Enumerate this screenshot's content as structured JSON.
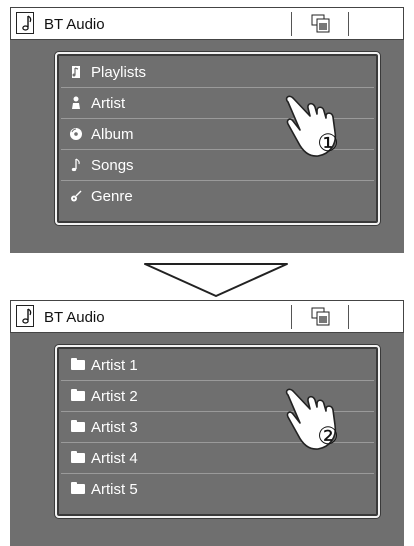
{
  "screen1": {
    "title": "BT Audio",
    "title_icon": "music-note-icon",
    "button_icon": "browse-source-icon",
    "items": [
      {
        "label": "Playlists",
        "icon": "playlist-icon"
      },
      {
        "label": "Artist",
        "icon": "artist-icon"
      },
      {
        "label": "Album",
        "icon": "album-icon"
      },
      {
        "label": "Songs",
        "icon": "music-note-icon"
      },
      {
        "label": "Genre",
        "icon": "guitar-icon"
      }
    ],
    "step": "①"
  },
  "transition_icon": "down-arrow-icon",
  "screen2": {
    "title": "BT Audio",
    "title_icon": "music-note-icon",
    "button_icon": "browse-source-icon",
    "items": [
      {
        "label": "Artist 1",
        "icon": "folder-icon"
      },
      {
        "label": "Artist 2",
        "icon": "folder-icon"
      },
      {
        "label": "Artist 3",
        "icon": "folder-icon"
      },
      {
        "label": "Artist 4",
        "icon": "folder-icon"
      },
      {
        "label": "Artist 5",
        "icon": "folder-icon"
      }
    ],
    "step": "②"
  },
  "colors": {
    "screen_bg": "#6f6f6f",
    "titlebar_bg": "#ffffff",
    "list_text": "#ffffff"
  }
}
